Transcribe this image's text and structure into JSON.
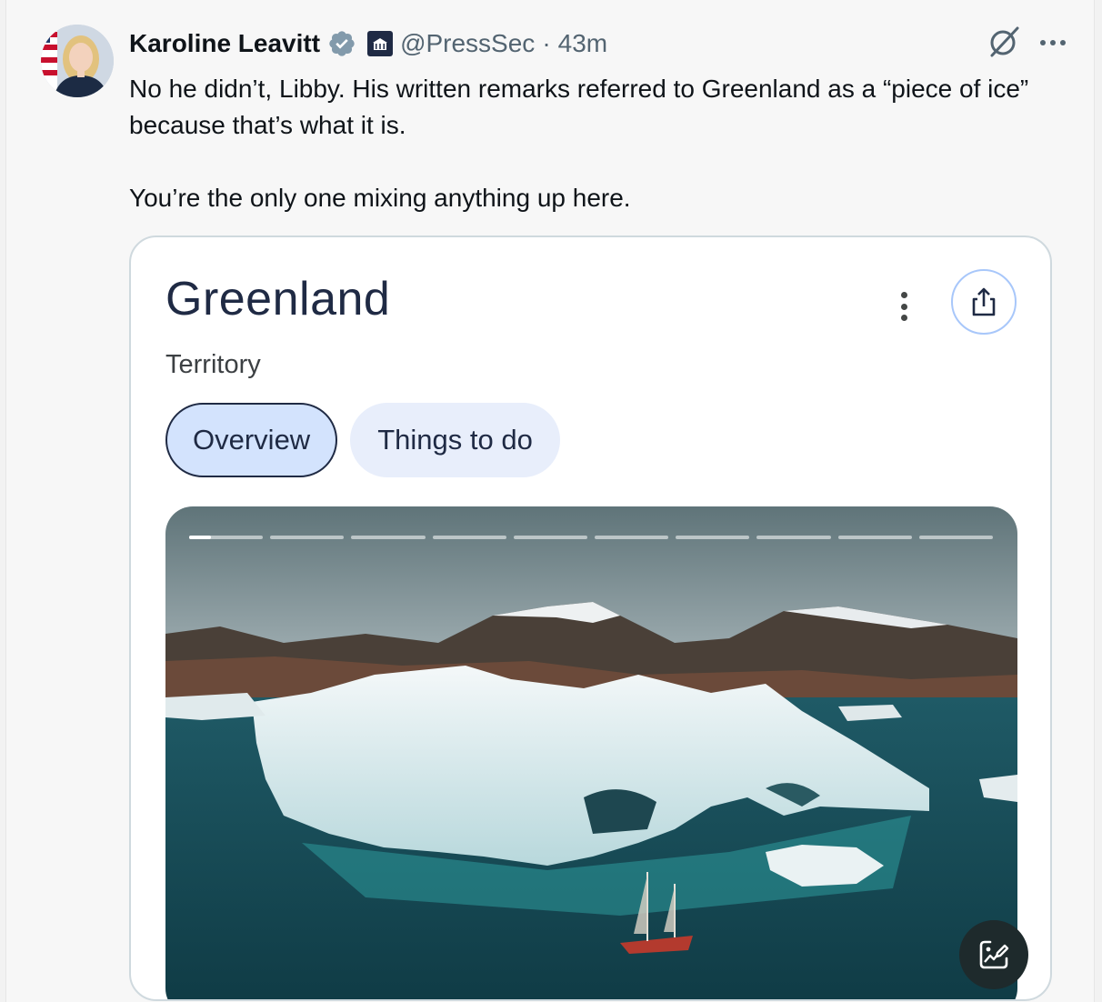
{
  "tweet": {
    "author_name": "Karoline Leavitt",
    "handle": "@PressSec",
    "separator": "·",
    "time": "43m",
    "paragraphs": [
      "No he didn’t, Libby. His written remarks referred to Greenland as a “piece of ice” because that’s what it is.",
      "You’re the only one mixing anything up here."
    ]
  },
  "card": {
    "title": "Greenland",
    "subtitle": "Territory",
    "tabs": [
      {
        "label": "Overview",
        "active": true
      },
      {
        "label": "Things to do",
        "active": false
      }
    ],
    "carousel": {
      "total_slides": 10,
      "current_slide": 1,
      "current_slide_progress": 0.3
    }
  },
  "icons": {
    "verified": "verified-badge-icon",
    "org": "white-house-icon",
    "grok": "grok-icon",
    "more": "more-horizontal-icon",
    "kebab": "more-vertical-icon",
    "share": "share-icon",
    "lens": "image-search-icon"
  },
  "colors": {
    "text": "#0f1419",
    "muted": "#536471",
    "verified": "#829aab",
    "tab_active_bg": "#d3e3fd",
    "tab_inactive_bg": "#e8eefb",
    "title": "#1f2a44"
  }
}
